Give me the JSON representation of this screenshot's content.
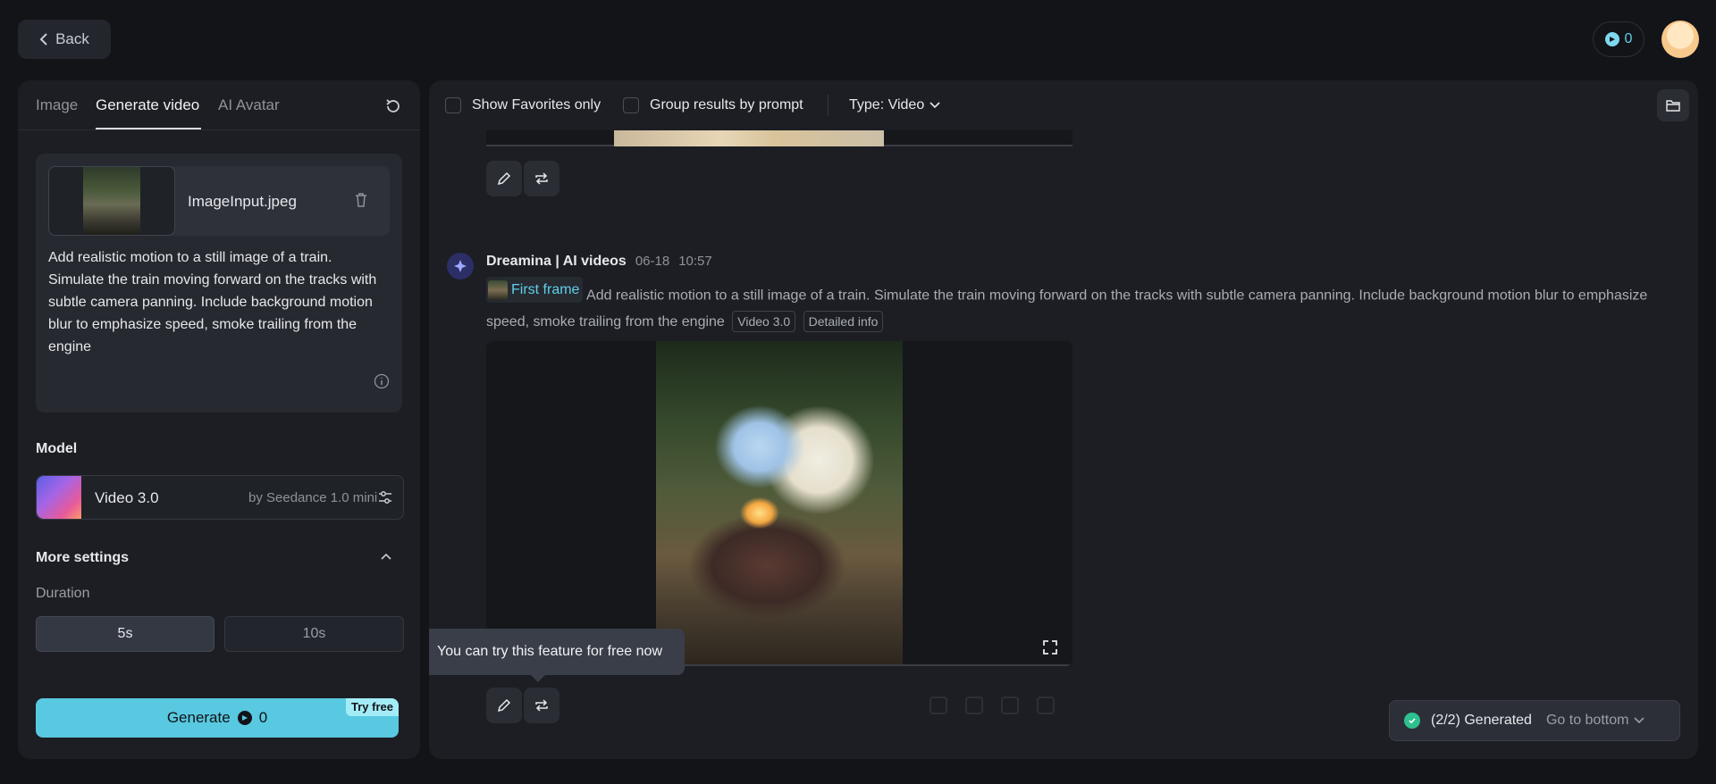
{
  "header": {
    "back_label": "Back",
    "credits": "0"
  },
  "left": {
    "tabs": [
      {
        "label": "Image"
      },
      {
        "label": "Generate video"
      },
      {
        "label": "AI Avatar"
      }
    ],
    "file_name": "ImageInput.jpeg",
    "prompt": "Add realistic motion to a still image of a train. Simulate the train moving forward on the tracks with subtle camera panning. Include background motion blur to emphasize speed, smoke trailing from the engine",
    "model_label": "Model",
    "model_name": "Video 3.0",
    "model_by": "by Seedance 1.0 mini",
    "more_settings": "More settings",
    "duration_label": "Duration",
    "durations": [
      {
        "label": "5s",
        "selected": true
      },
      {
        "label": "10s",
        "selected": false
      }
    ],
    "generate_label": "Generate",
    "generate_cost": "0",
    "try_free": "Try free"
  },
  "right": {
    "filters": {
      "favorites": "Show Favorites only",
      "group": "Group results by prompt",
      "type": "Type: Video"
    },
    "message": {
      "sender": "Dreamina | AI videos",
      "date": "06-18",
      "time": "10:57",
      "first_frame": "First frame",
      "prompt": "Add realistic motion to a still image of a train. Simulate the train moving forward on the tracks with subtle camera panning. Include background motion blur to emphasize speed, smoke trailing from the engine",
      "tags": [
        "Video 3.0",
        "Detailed info"
      ]
    },
    "tooltip": "You can try this feature for free now",
    "toast": {
      "status": "(2/2) Generated",
      "link": "Go to bottom"
    }
  },
  "colors": {
    "accent": "#58c9e0",
    "background": "#131418",
    "panel": "#1c1e23",
    "success": "#2ec08f"
  }
}
